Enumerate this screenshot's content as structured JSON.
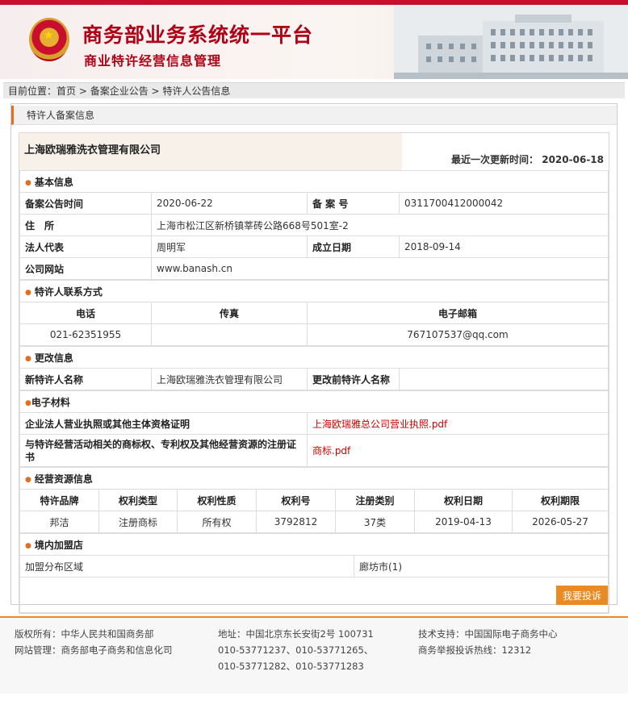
{
  "header": {
    "title": "商务部业务系统统一平台",
    "subtitle": "商业特许经营信息管理"
  },
  "breadcrumb": {
    "prefix": "目前位置：",
    "home": "首页",
    "sep1": " > ",
    "list": "备案企业公告",
    "sep2": " > ",
    "current": "特许人公告信息"
  },
  "section_title": "特许人备案信息",
  "company": {
    "name": "上海欧瑞雅洗衣管理有限公司",
    "updated_label": "最近一次更新时间：",
    "updated_value": "2020-06-18"
  },
  "basic": {
    "title": "基本信息",
    "notice_time_label": "备案公告时间",
    "notice_time": "2020-06-22",
    "record_no_label": "备 案 号",
    "record_no": "0311700412000042",
    "address_label": "住　所",
    "address": "上海市松江区新桥镇莘砖公路668号501室-2",
    "legal_rep_label": "法人代表",
    "legal_rep": "周明军",
    "founded_label": "成立日期",
    "founded": "2018-09-14",
    "website_label": "公司网站",
    "website": "www.banash.cn"
  },
  "contact": {
    "title": "特许人联系方式",
    "phone_label": "电话",
    "fax_label": "传真",
    "email_label": "电子邮箱",
    "phone": "021-62351955",
    "fax": "",
    "email": "767107537@qq.com"
  },
  "change": {
    "title": "更改信息",
    "new_name_label": "新特许人名称",
    "new_name": "上海欧瑞雅洗衣管理有限公司",
    "old_name_label": "更改前特许人名称",
    "old_name": ""
  },
  "materials": {
    "title": "电子材料",
    "license_label": "企业法人营业执照或其他主体资格证明",
    "license_file": "上海欧瑞雅总公司营业执照.pdf",
    "trademark_label": "与特许经营活动相关的商标权、专利权及其他经营资源的注册证书",
    "trademark_file": "商标.pdf"
  },
  "resources": {
    "title": "经营资源信息",
    "headers": [
      "特许品牌",
      "权利类型",
      "权利性质",
      "权利号",
      "注册类别",
      "权利日期",
      "权利期限"
    ],
    "row": [
      "邦洁",
      "注册商标",
      "所有权",
      "3792812",
      "37类",
      "2019-04-13",
      "2026-05-27"
    ]
  },
  "stores": {
    "title": "境内加盟店",
    "region_label": "加盟分布区域",
    "region_value": "廊坊市(1)"
  },
  "complain_button": "我要投诉",
  "footer": {
    "copyright": "版权所有：中华人民共和国商务部",
    "site_admin": "网站管理：商务部电子商务和信息化司",
    "address": "地址：中国北京东长安街2号 100731",
    "phones1": "010-53771237、010-53771265、",
    "phones2": "010-53771282、010-53771283",
    "tech": "技术支持：中国国际电子商务中心",
    "hotline": "商务举报投诉热线：12312"
  },
  "colors": {
    "brand_red": "#b00016",
    "accent_orange": "#e98a22",
    "link_red": "#cc0000"
  }
}
